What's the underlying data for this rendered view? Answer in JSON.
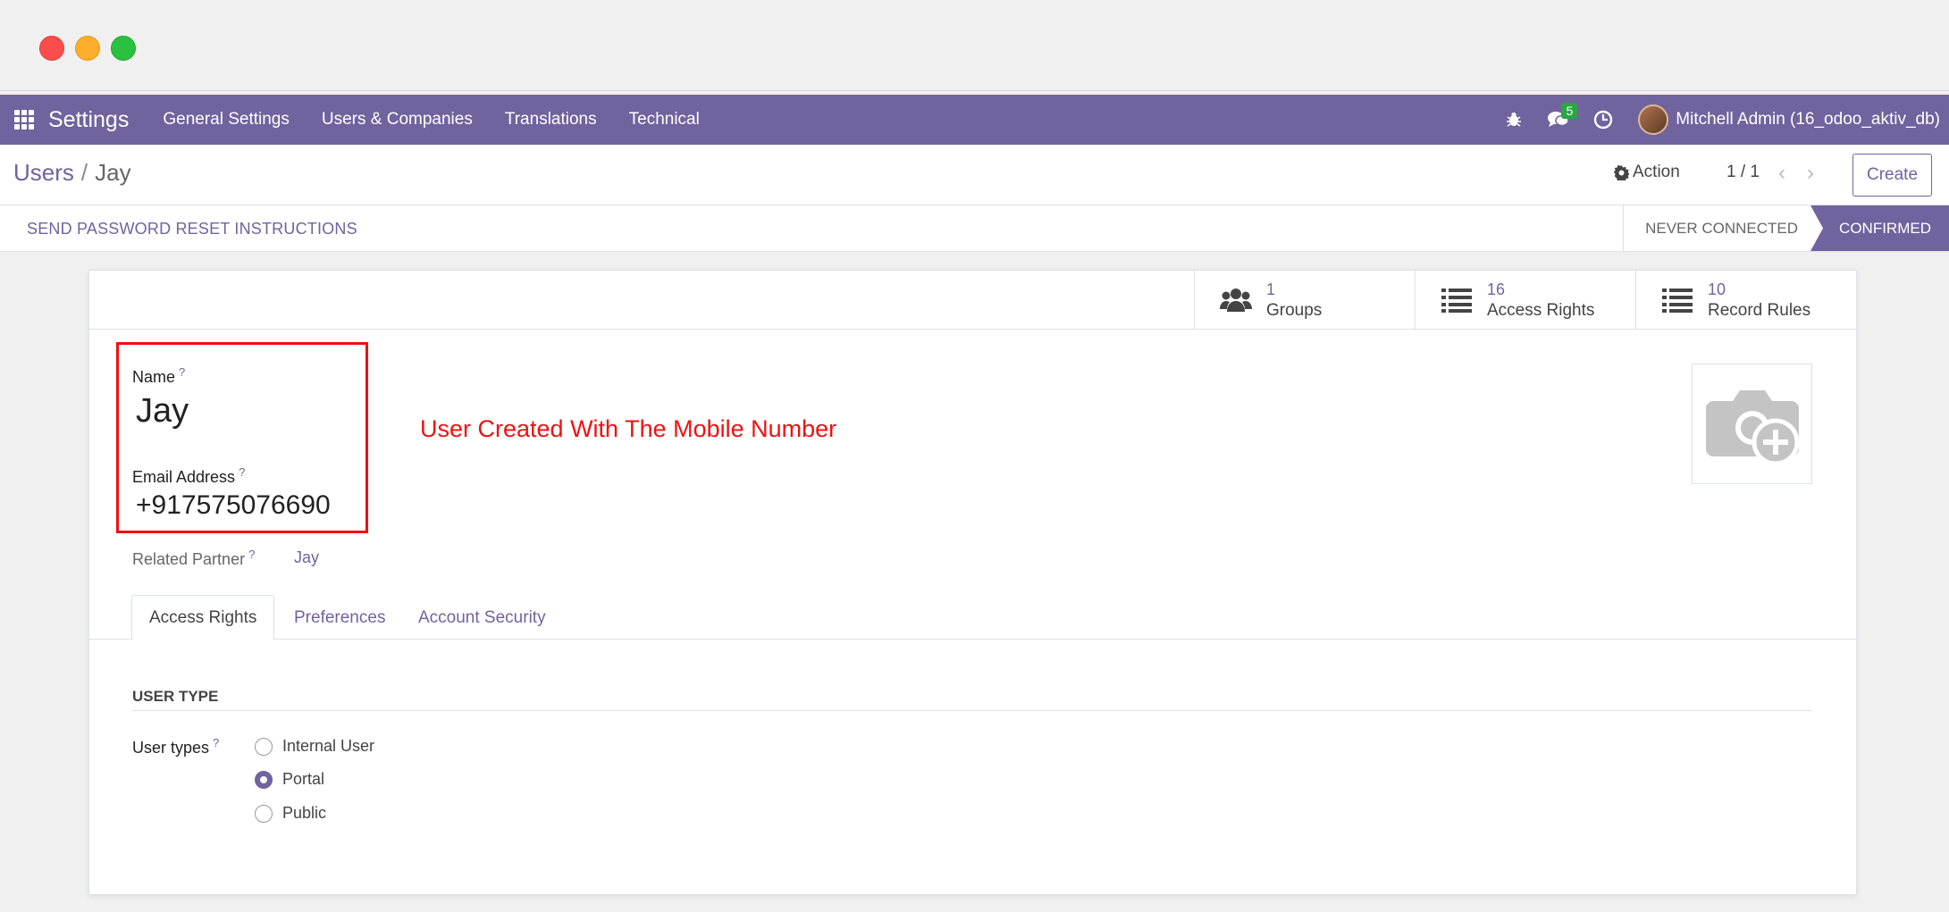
{
  "navbar": {
    "brand": "Settings",
    "items": [
      "General Settings",
      "Users & Companies",
      "Translations",
      "Technical"
    ],
    "chat_badge": "5",
    "user": "Mitchell Admin (16_odoo_aktiv_db)",
    "color": "#71639e"
  },
  "control": {
    "breadcrumb_parent": "Users",
    "breadcrumb_sep": "/",
    "breadcrumb_current": "Jay",
    "action_label": "Action",
    "pager": "1 / 1",
    "create_label": "Create"
  },
  "statusbar": {
    "reset_button": "SEND PASSWORD RESET INSTRUCTIONS",
    "stages": [
      "NEVER CONNECTED",
      "CONFIRMED"
    ],
    "active_stage": "CONFIRMED"
  },
  "stats": [
    {
      "num": "1",
      "label": "Groups",
      "icon": "users-icon"
    },
    {
      "num": "16",
      "label": "Access Rights",
      "icon": "list-icon"
    },
    {
      "num": "10",
      "label": "Record Rules",
      "icon": "list-icon"
    }
  ],
  "form": {
    "name_label": "Name",
    "name_value": "Jay",
    "email_label": "Email Address",
    "email_value": "+917575076690",
    "help_mark": "?",
    "related_partner_label": "Related Partner",
    "related_partner_value": "Jay",
    "annotation": "User Created With The Mobile Number"
  },
  "tabs": [
    "Access Rights",
    "Preferences",
    "Account Security"
  ],
  "active_tab": "Access Rights",
  "user_type_section": {
    "title": "USER TYPE",
    "label": "User types",
    "options": [
      "Internal User",
      "Portal",
      "Public"
    ],
    "selected": "Portal"
  }
}
